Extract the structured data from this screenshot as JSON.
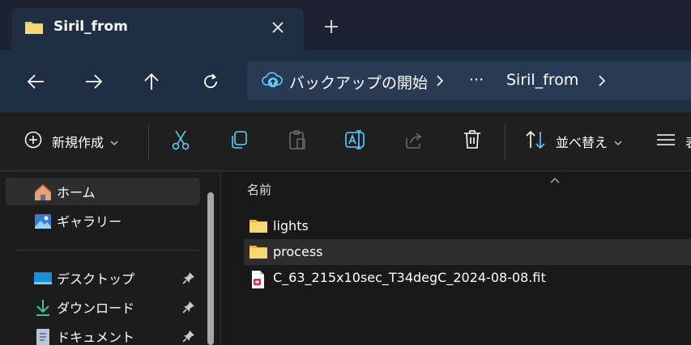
{
  "tab": {
    "title": "Siril_from",
    "close_icon": "close-icon",
    "new_tab_icon": "plus-icon"
  },
  "nav": {
    "back_icon": "arrow-left-icon",
    "forward_icon": "arrow-right-icon",
    "up_icon": "arrow-up-icon",
    "refresh_icon": "refresh-icon"
  },
  "address": {
    "segment1": "バックアップの開始",
    "ellipsis": "···",
    "segment2": "Siril_from"
  },
  "toolbar": {
    "new_label": "新規作成",
    "sort_label": "並べ替え",
    "view_label": "表"
  },
  "sidebar": {
    "items": [
      {
        "label": "ホーム",
        "icon": "home-icon"
      },
      {
        "label": "ギャラリー",
        "icon": "gallery-icon"
      },
      {
        "label": "デスクトップ",
        "icon": "desktop-icon"
      },
      {
        "label": "ダウンロード",
        "icon": "download-icon"
      },
      {
        "label": "ドキュメント",
        "icon": "documents-icon"
      }
    ]
  },
  "content": {
    "column_name": "名前",
    "rows": [
      {
        "name": "lights",
        "type": "folder"
      },
      {
        "name": "process",
        "type": "folder"
      },
      {
        "name": "C_63_215x10sec_T34degC_2024-08-08.fit",
        "type": "file"
      }
    ]
  },
  "colors": {
    "accent": "#60cdff",
    "folder": "#f3c75a",
    "titlebar": "#1c2232",
    "navbar": "#202e44"
  }
}
